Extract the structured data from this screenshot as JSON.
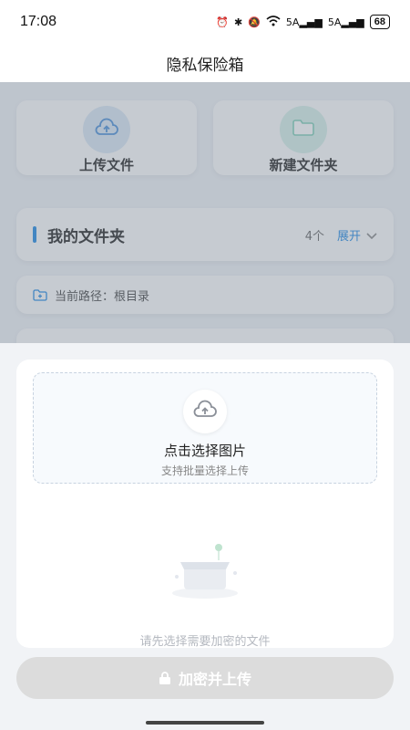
{
  "status_bar": {
    "time": "17:08",
    "signal_1": "5A",
    "signal_2": "5A",
    "battery": "68"
  },
  "header": {
    "title": "隐私保险箱"
  },
  "actions": {
    "upload_label": "上传文件",
    "new_folder_label": "新建文件夹"
  },
  "folders": {
    "title": "我的文件夹",
    "count": "4个",
    "expand_label": "展开"
  },
  "path": {
    "text": "当前路径：根目录"
  },
  "sheet": {
    "dropzone_title": "点击选择图片",
    "dropzone_subtitle": "支持批量选择上传",
    "empty_text": "请先选择需要加密的文件",
    "upload_button": "加密并上传"
  },
  "colors": {
    "accent": "#1e88e5",
    "disabled_button": "#dcdcdc"
  },
  "icons": [
    "alarm-icon",
    "bluetooth-icon",
    "mute-icon",
    "wifi-icon",
    "signal-icon",
    "battery-icon",
    "cloud-upload-icon",
    "folder-icon",
    "chevron-down-icon",
    "folder-path-icon",
    "lock-icon"
  ]
}
